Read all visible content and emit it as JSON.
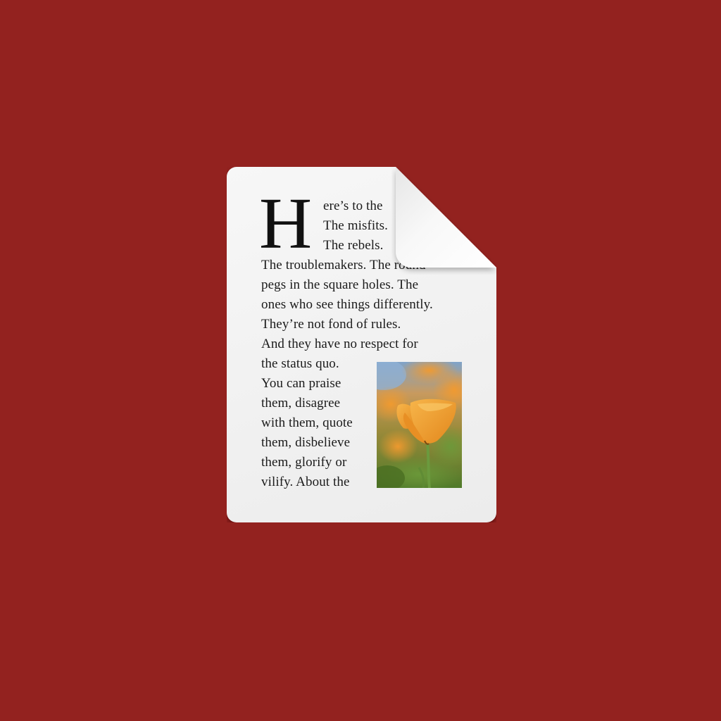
{
  "colors": {
    "background": "#93221f",
    "paper": "#f2f2f2",
    "text": "#1b1b1b",
    "flower": "#f2a12a",
    "foliage": "#5a7a2e"
  },
  "icon": {
    "name": "text-document-icon",
    "drop_cap": "H",
    "lines": [
      "ere’s to the",
      "The misfits.",
      "The rebels.",
      "The troublemakers. The round",
      "pegs in the square holes. The",
      "ones who see things differently.",
      "They’re not fond of rules.",
      "And they have no respect for",
      "the status quo.",
      "You can praise",
      "them, disagree",
      "with them, quote",
      "them, disbelieve",
      "them, glorify or",
      "vilify. About the"
    ],
    "image": "poppy-flower-photo"
  }
}
